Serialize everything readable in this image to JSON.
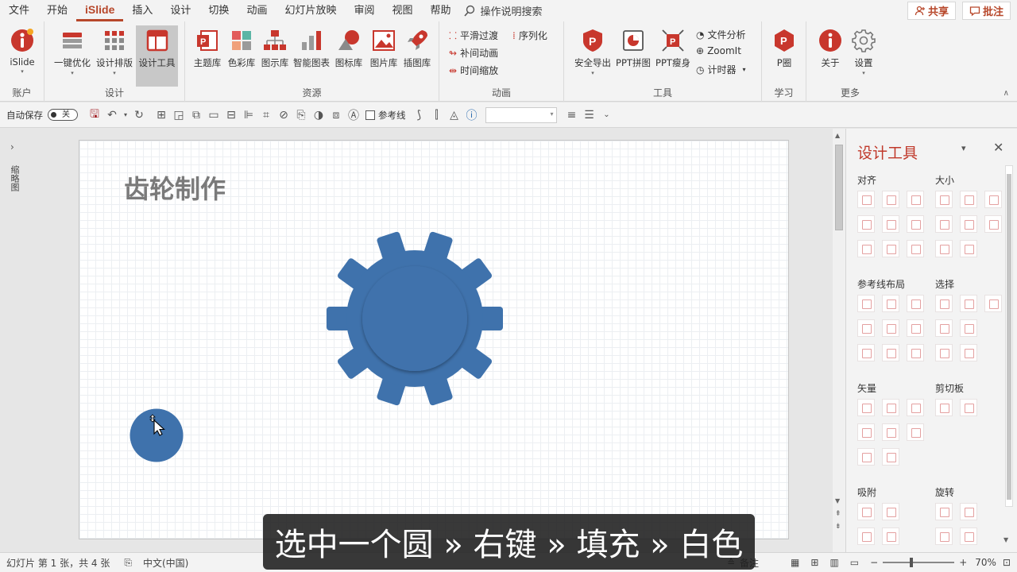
{
  "menu": {
    "items": [
      "文件",
      "开始",
      "iSlide",
      "插入",
      "设计",
      "切换",
      "动画",
      "幻灯片放映",
      "审阅",
      "视图",
      "帮助"
    ],
    "active_index": 2,
    "search_label": "操作说明搜索",
    "share_label": "共享",
    "comment_label": "批注"
  },
  "ribbon": {
    "account": {
      "label": "账户",
      "btn": "iSlide"
    },
    "design": {
      "label": "设计",
      "btns": [
        "一键优化",
        "设计排版",
        "设计工具"
      ]
    },
    "resources": {
      "label": "资源",
      "btns": [
        "主题库",
        "色彩库",
        "图示库",
        "智能图表",
        "图标库",
        "图片库",
        "插图库"
      ]
    },
    "animation": {
      "label": "动画",
      "btns": [
        "平滑过渡",
        "序列化",
        "补间动画",
        "时间缩放"
      ]
    },
    "tools": {
      "label": "工具",
      "btns": [
        "安全导出",
        "PPT拼图",
        "PPT瘦身"
      ],
      "small": [
        "文件分析",
        "ZoomIt",
        "计时器"
      ]
    },
    "learn": {
      "label": "学习",
      "btn": "P圈"
    },
    "more": {
      "label": "更多",
      "btns": [
        "关于",
        "设置"
      ]
    }
  },
  "quickbar": {
    "autosave": "自动保存",
    "toggle": "关",
    "guides": "参考线"
  },
  "leftpanel": {
    "label": "缩略图"
  },
  "slide": {
    "title": "齿轮制作"
  },
  "pane": {
    "title": "设计工具",
    "sections": {
      "align": "对齐",
      "size": "大小",
      "guide": "参考线布局",
      "select": "选择",
      "vector": "矢量",
      "clipboard": "剪切板",
      "snap": "吸附",
      "rotate": "旋转"
    }
  },
  "status": {
    "slide_info": "幻灯片 第 1 张，共 4 张",
    "language": "中文(中国)",
    "notes": "备注",
    "zoom": "70%"
  },
  "subtitle": "选中一个圆 » 右键 » 填充 » 白色",
  "colors": {
    "accent": "#b7472a",
    "gear": "#3f72ac",
    "pane_title": "#c0392b"
  }
}
